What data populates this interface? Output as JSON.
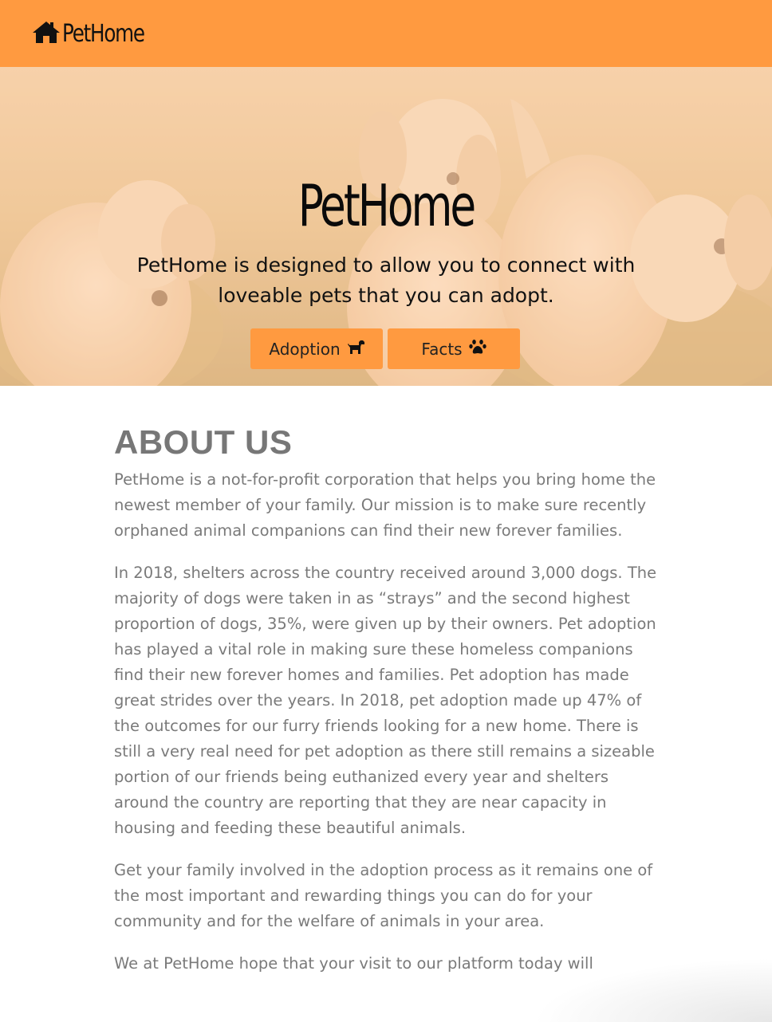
{
  "navbar": {
    "brand_label": "PetHome",
    "brand_icon": "house-icon",
    "background": "#ff9a40"
  },
  "hero": {
    "title": "PetHome",
    "description": "PetHome is designed to allow you to connect with loveable pets that you can adopt.",
    "buttons": [
      {
        "label": "Adoption",
        "icon": "dog-icon"
      },
      {
        "label": "Facts",
        "icon": "paw-icon"
      }
    ],
    "button_color": "#ff9a40"
  },
  "about": {
    "heading": "ABOUT US",
    "paragraphs": [
      "PetHome is a not-for-profit corporation that helps you bring home the newest member of your family. Our mission is to make sure recently orphaned animal companions can find their new forever families.",
      "In 2018, shelters across the country received around 3,000 dogs. The majority of dogs were taken in as “strays” and the second highest proportion of dogs, 35%, were given up by their owners. Pet adoption has played a vital role in making sure these homeless companions find their new forever homes and families. Pet adoption has made great strides over the years. In 2018, pet adoption made up 47% of the outcomes for our furry friends looking for a new home. There is still a very real need for pet adoption as there still remains a sizeable portion of our friends being euthanized every year and shelters around the country are reporting that they are near capacity in housing and feeding these beautiful animals.",
      "Get your family involved in the adoption process as it remains one of the most important and rewarding things you can do for your community and for the welfare of animals in your area.",
      "We at PetHome hope that your visit to our platform today will"
    ]
  }
}
